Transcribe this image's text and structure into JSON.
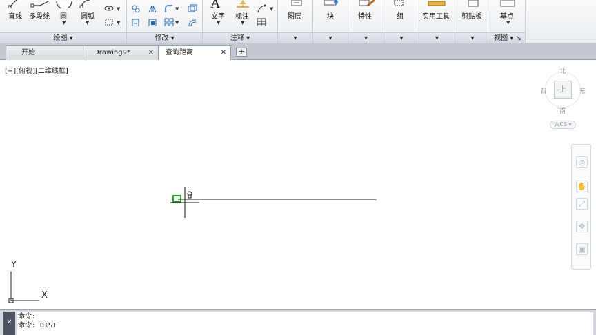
{
  "ribbon": {
    "draw": {
      "title": "绘图",
      "line_label": "直线",
      "polyline_label": "多段线",
      "circle_label": "圆",
      "arc_label": "圆弧"
    },
    "modify": {
      "title": "修改"
    },
    "annotation": {
      "title": "注释",
      "text_label": "文字",
      "dimension_label": "标注"
    },
    "layers_label": "图层",
    "block_label": "块",
    "properties_label": "特性",
    "groups_label": "组",
    "utilities_label": "实用工具",
    "clipboard_label": "剪贴板",
    "view": {
      "title": "视图",
      "base_label": "基点"
    }
  },
  "tabs": [
    {
      "label": "开始",
      "closable": false
    },
    {
      "label": "Drawing9*",
      "closable": true
    },
    {
      "label": "查询距离",
      "closable": true
    }
  ],
  "viewport_label": "[−][俯视][二维线框]",
  "viewcube": {
    "north": "北",
    "south": "南",
    "east": "东",
    "west": "西",
    "face": "上",
    "wcs": "WCS"
  },
  "ucs": {
    "x_label": "X",
    "y_label": "Y"
  },
  "command_line": {
    "lines": [
      "命令:",
      "命令: DIST"
    ]
  },
  "colors": {
    "ribbon_bg": "#eceff2",
    "tabbar_bg": "#c4c9d1",
    "canvas_bg": "#ffffff",
    "command_bg": "#d4d8de",
    "snap_marker": "#1fa31f"
  },
  "icons": {
    "line": "line-icon",
    "polyline": "polyline-icon",
    "circle": "circle-icon",
    "arc": "arc-icon"
  }
}
